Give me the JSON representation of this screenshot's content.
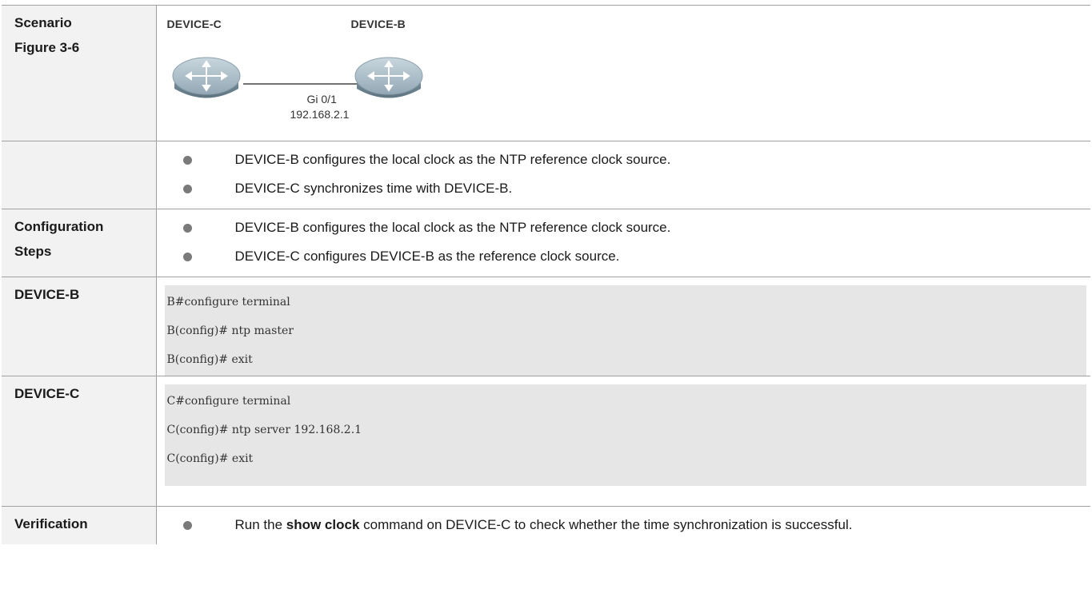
{
  "table": {
    "scenario": {
      "header_line1": "Scenario",
      "header_line2": "Figure 3-6",
      "diagram": {
        "left_device": "DEVICE-C",
        "right_device": "DEVICE-B",
        "port": "Gi 0/1",
        "ip": "192.168.2.1",
        "device_icon": "router-icon"
      }
    },
    "notes": {
      "header": "",
      "items": [
        "DEVICE-B configures the local clock as the NTP reference clock source.",
        "DEVICE-C synchronizes time with DEVICE-B."
      ]
    },
    "steps": {
      "header_line1": "Configuration",
      "header_line2": "Steps",
      "items": [
        "DEVICE-B configures the local clock as the NTP reference clock source.",
        "DEVICE-C configures DEVICE-B as the reference clock source."
      ]
    },
    "device_b": {
      "header": "DEVICE-B",
      "lines": [
        "B#configure terminal",
        "B(config)# ntp master",
        "B(config)# exit"
      ]
    },
    "device_c": {
      "header": "DEVICE-C",
      "lines": [
        "C#configure terminal",
        "C(config)# ntp server 192.168.2.1",
        "C(config)# exit"
      ]
    },
    "verification": {
      "header": "Verification",
      "text_before": "Run the ",
      "command": "show clock",
      "text_after": " command on DEVICE-C to check whether the time synchronization is successful."
    }
  }
}
